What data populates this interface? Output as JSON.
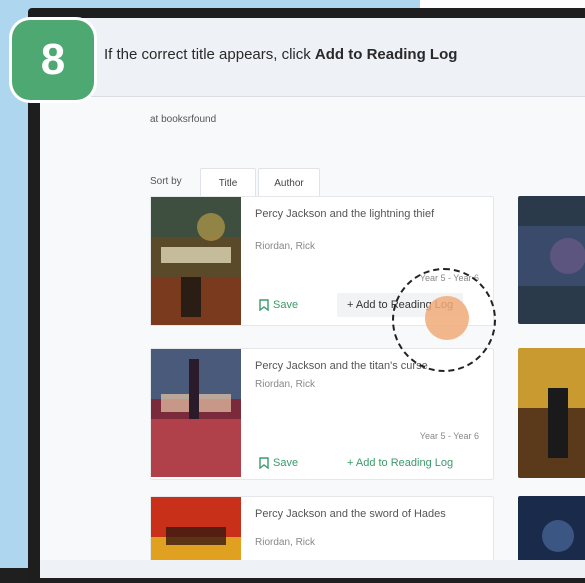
{
  "step": {
    "number": "8",
    "instruction_prefix": "If the correct title appears, click ",
    "instruction_action": "Add to Reading Log"
  },
  "search": {
    "results_text": "at booksrfound"
  },
  "sort": {
    "label": "Sort by",
    "options": [
      "Title",
      "Author"
    ]
  },
  "books": [
    {
      "title": "Percy Jackson and the lightning thief",
      "author": "Riordan, Rick",
      "years": "Year 5 - Year 6",
      "save_label": "Save",
      "add_label": "+ Add to Reading Log"
    },
    {
      "title": "Percy Jackson and the titan's curse",
      "author": "Riordan, Rick",
      "years": "Year 5 - Year 6",
      "save_label": "Save",
      "add_label": "+ Add to Reading Log"
    },
    {
      "title": "Percy Jackson and the sword of Hades",
      "author": "Riordan, Rick"
    }
  ],
  "colors": {
    "accent": "#4ea872",
    "link": "#3b9a6a",
    "highlight_dot": "#f1aa78"
  }
}
